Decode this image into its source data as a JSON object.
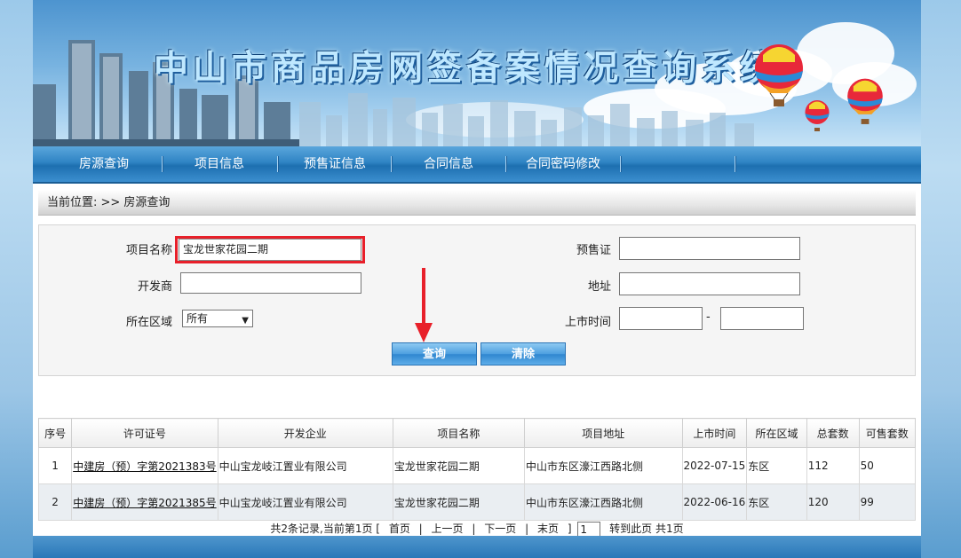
{
  "header": {
    "title": "中山市商品房网签备案情况查询系统"
  },
  "nav": [
    {
      "label": "房源查询"
    },
    {
      "label": "项目信息"
    },
    {
      "label": "预售证信息"
    },
    {
      "label": "合同信息"
    },
    {
      "label": "合同密码修改"
    }
  ],
  "breadcrumb": "当前位置: >> 房源查询",
  "form": {
    "project_name_label": "项目名称",
    "project_name_value": "宝龙世家花园二期",
    "developer_label": "开发商",
    "developer_value": "",
    "district_label": "所在区域",
    "district_value": "所有",
    "presale_label": "预售证",
    "presale_value": "",
    "address_label": "地址",
    "address_value": "",
    "listing_time_label": "上市时间",
    "listing_time_from": "",
    "listing_time_to": "",
    "range_sep": "-",
    "query_button": "查询",
    "clear_button": "清除"
  },
  "table": {
    "headers": [
      "序号",
      "许可证号",
      "开发企业",
      "项目名称",
      "项目地址",
      "上市时间",
      "所在区域",
      "总套数",
      "可售套数"
    ],
    "rows": [
      [
        "1",
        "中建房（预）字第2021383号",
        "中山宝龙岐江置业有限公司",
        "宝龙世家花园二期",
        "中山市东区濠江西路北侧",
        "2022-07-15",
        "东区",
        "112",
        "50"
      ],
      [
        "2",
        "中建房（预）字第2021385号",
        "中山宝龙岐江置业有限公司",
        "宝龙世家花园二期",
        "中山市东区濠江西路北侧",
        "2022-06-16",
        "东区",
        "120",
        "99"
      ]
    ]
  },
  "pager": {
    "summary": "共2条记录,当前第1页 [",
    "first": "首页",
    "sep1": "|",
    "prev": "上一页",
    "sep2": "|",
    "next": "下一页",
    "sep3": "|",
    "last": "末页",
    "close": "]",
    "page_input": "1",
    "goto": "转到此页 共1页"
  },
  "colors": {
    "highlight": "#e8202a",
    "nav": "#2f84c4",
    "button": "#4d9fe0"
  },
  "icons": {
    "arrow": "down-arrow-icon",
    "select_chevron": "chevron-down-icon"
  }
}
